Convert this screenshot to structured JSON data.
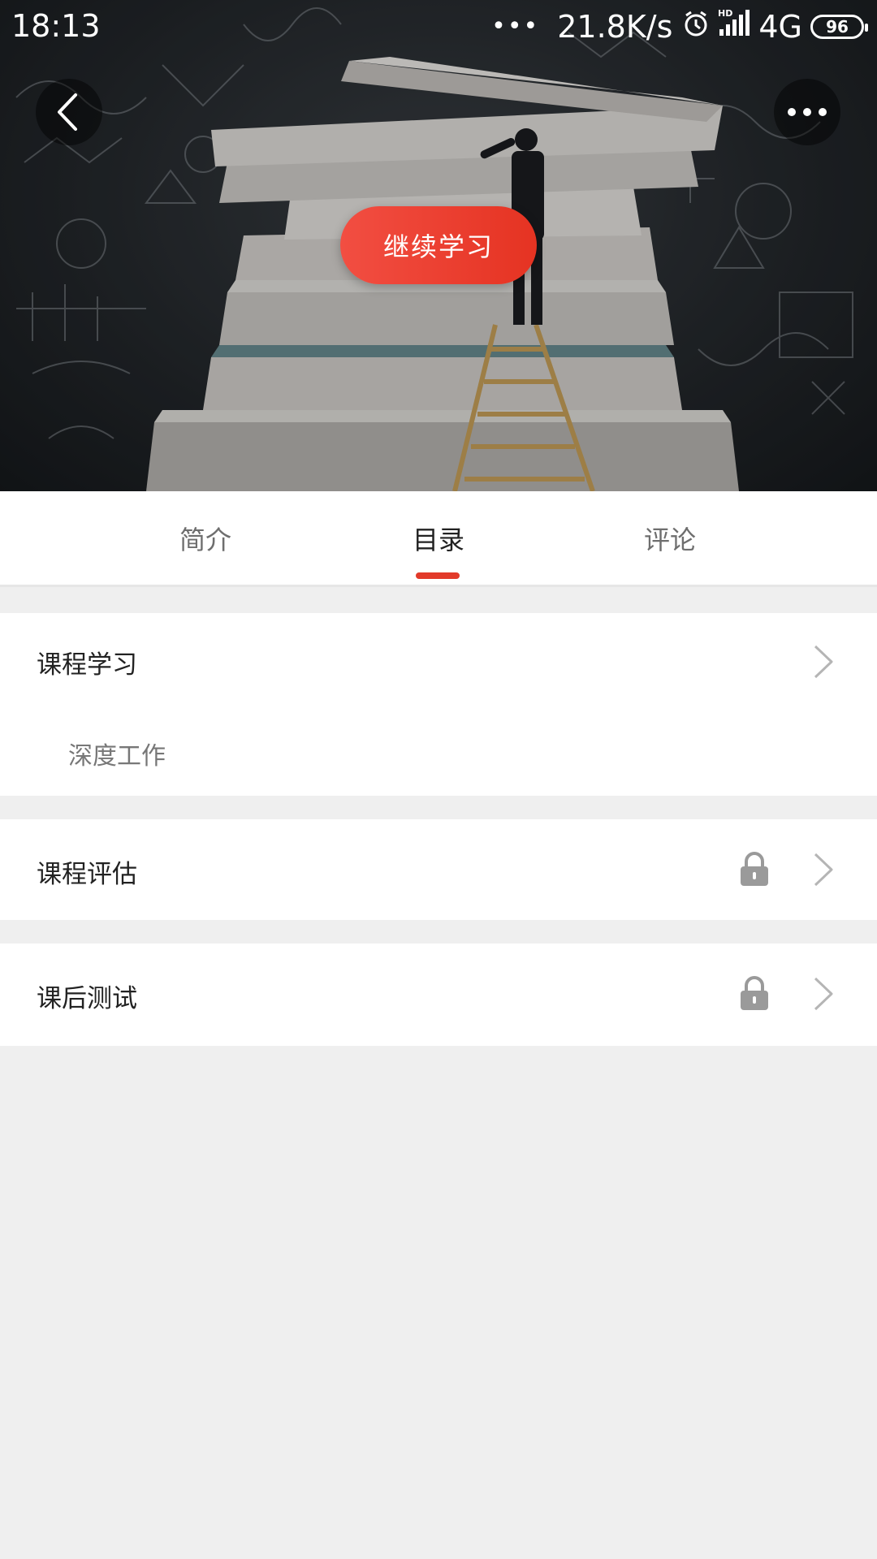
{
  "status_bar": {
    "time": "18:13",
    "dots": "•••",
    "speed": "21.8K/s",
    "hd": "HD",
    "network": "4G",
    "battery": "96"
  },
  "hero": {
    "continue_label": "继续学习"
  },
  "tabs": [
    {
      "label": "简介",
      "active": false
    },
    {
      "label": "目录",
      "active": true
    },
    {
      "label": "评论",
      "active": false
    }
  ],
  "catalog": {
    "sections": [
      {
        "title": "课程学习",
        "locked": false,
        "items": [
          "深度工作"
        ]
      },
      {
        "title": "课程评估",
        "locked": true
      },
      {
        "title": "课后测试",
        "locked": true
      }
    ]
  },
  "colors": {
    "accent": "#e53322",
    "background": "#efefef",
    "icon_gray": "#9a9a9a"
  },
  "icons": [
    "back-icon",
    "more-icon",
    "chevron-right-icon",
    "lock-icon",
    "alarm-icon",
    "signal-icon",
    "battery-icon"
  ]
}
